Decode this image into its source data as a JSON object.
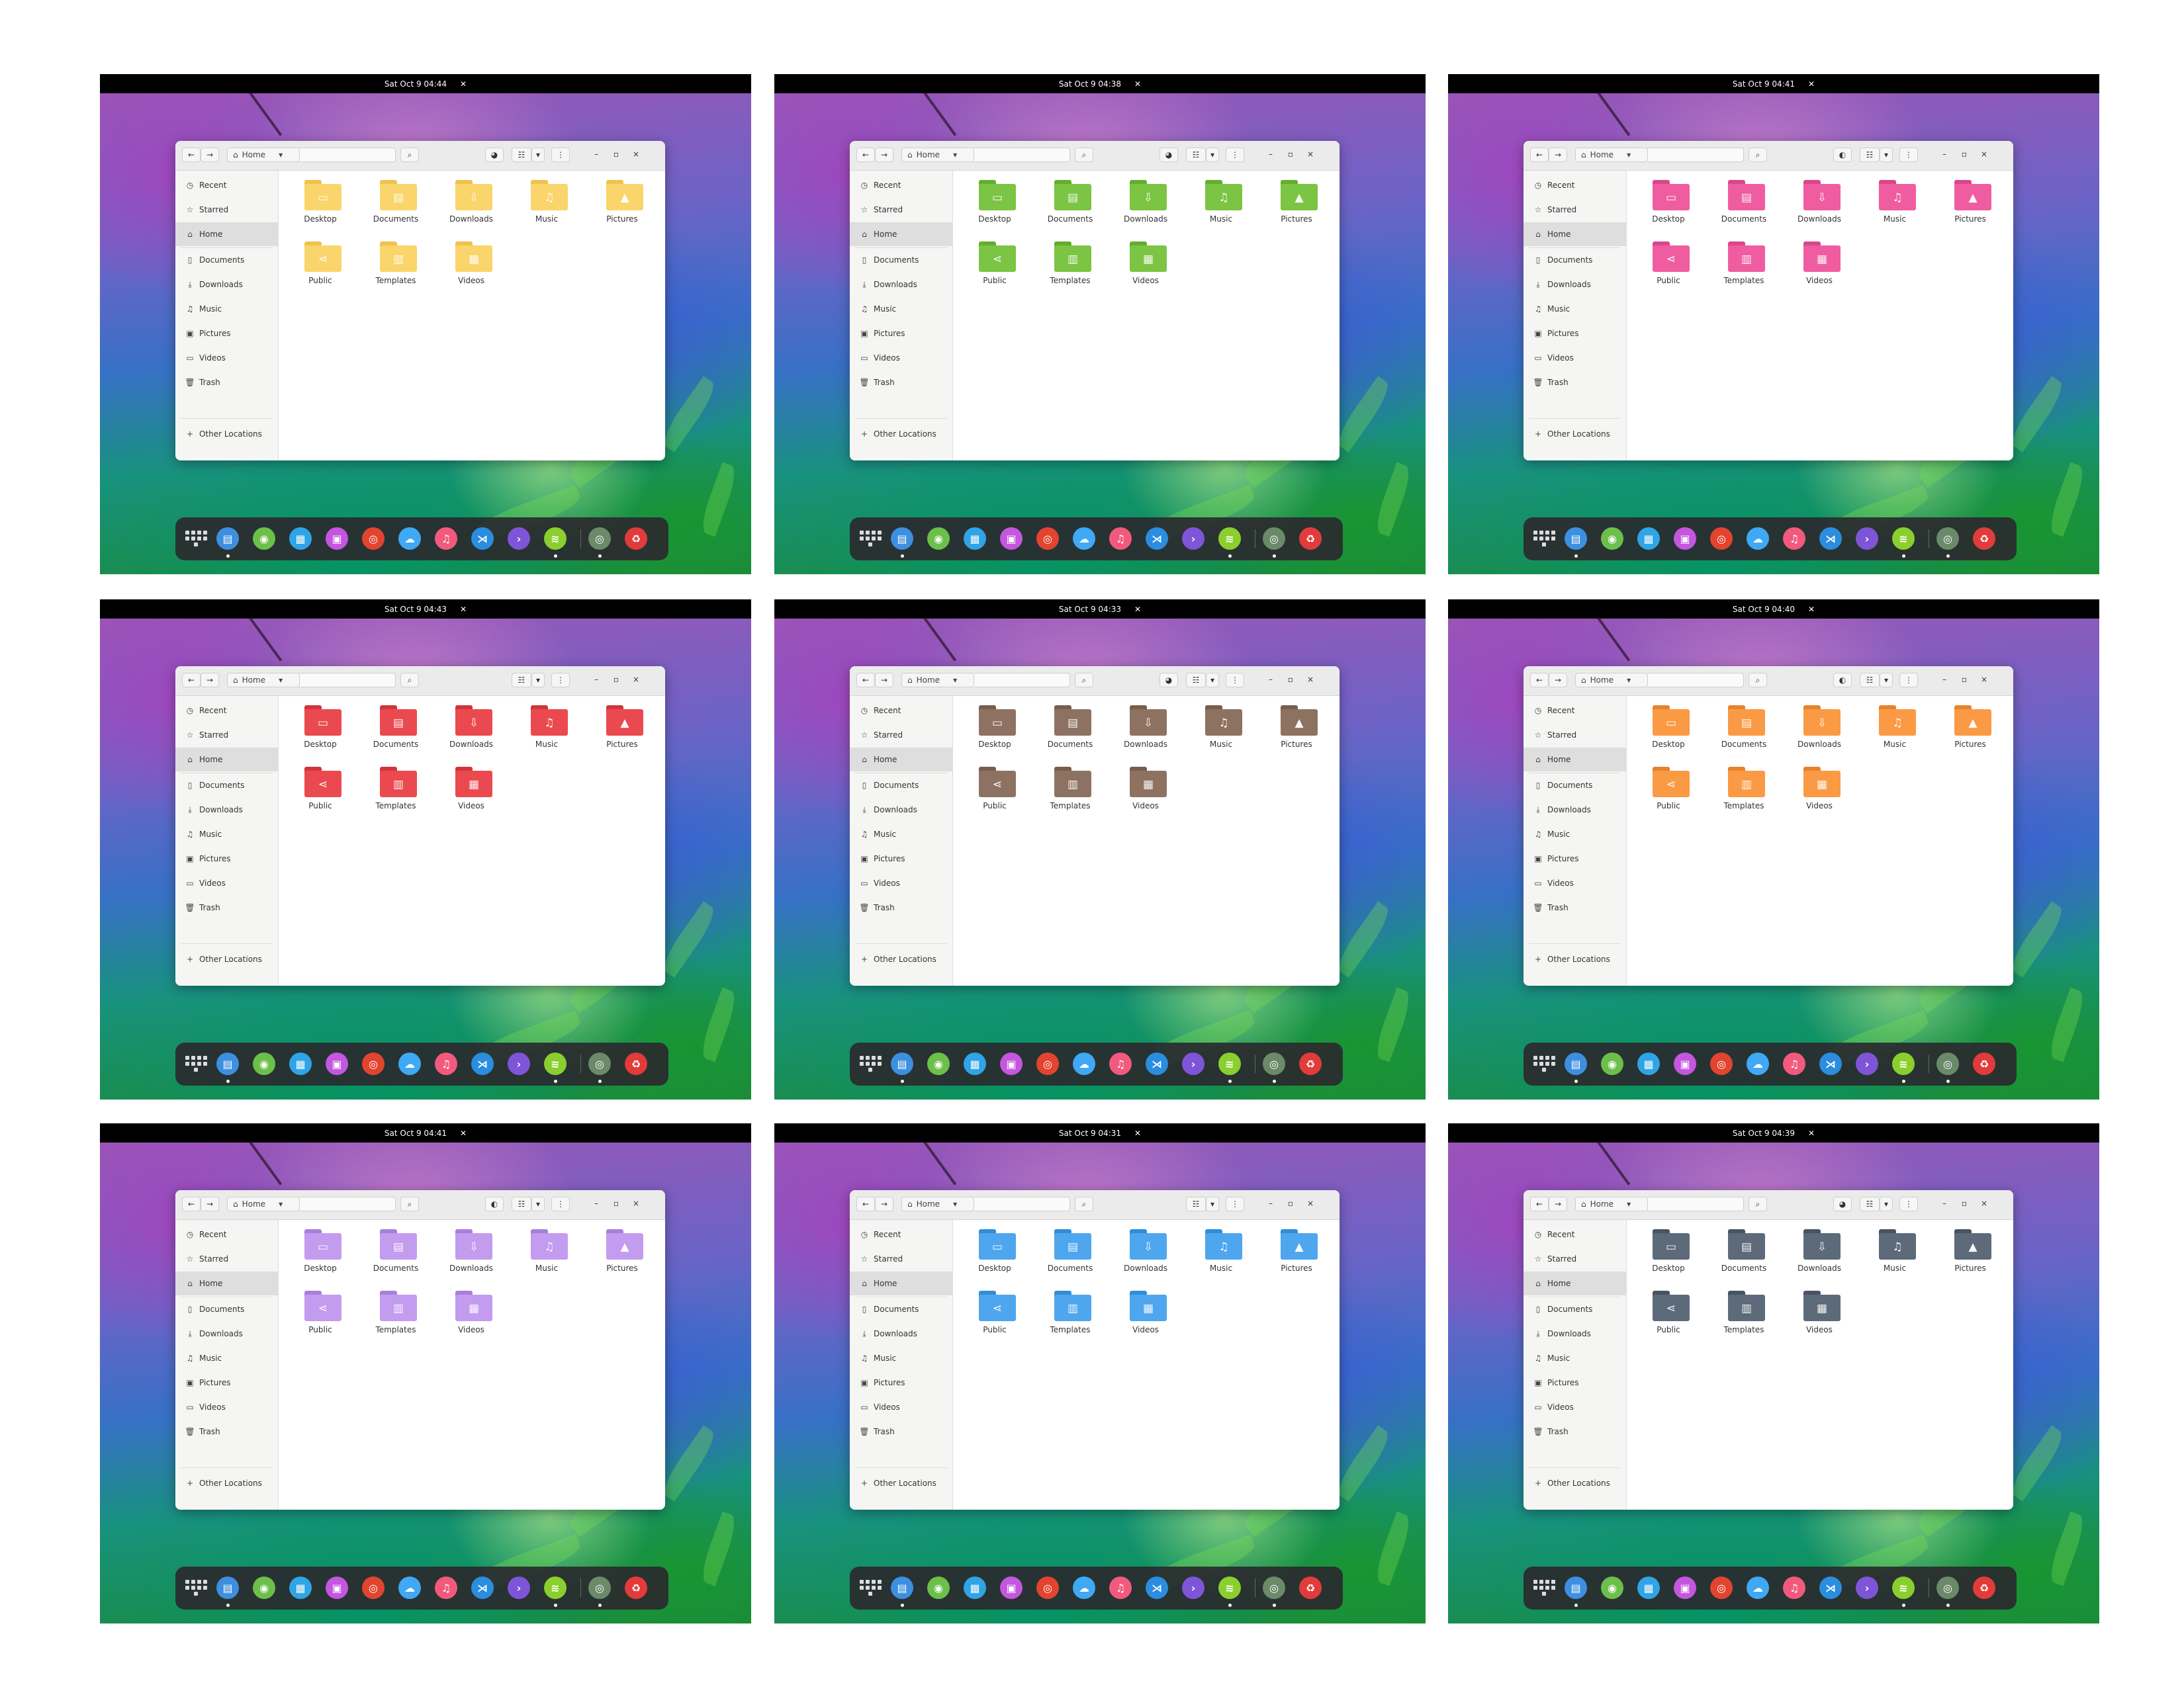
{
  "screenshots": [
    {
      "time": "Sat Oct 9  04:44",
      "folder_color": "#f9d56b",
      "folder_tab": "#efc24e",
      "has_theme_toggle": true,
      "theme_icon": "◕"
    },
    {
      "time": "Sat Oct 9  04:38",
      "folder_color": "#7cc443",
      "folder_tab": "#64ad2d",
      "has_theme_toggle": true,
      "theme_icon": "◕"
    },
    {
      "time": "Sat Oct 9  04:41",
      "folder_color": "#ef5da0",
      "folder_tab": "#d9478a",
      "has_theme_toggle": true,
      "theme_icon": "◐"
    },
    {
      "time": "Sat Oct 9  04:43",
      "folder_color": "#ea4a4f",
      "folder_tab": "#cf353b",
      "has_theme_toggle": false,
      "theme_icon": ""
    },
    {
      "time": "Sat Oct 9  04:33",
      "folder_color": "#8e7261",
      "folder_tab": "#775d4e",
      "has_theme_toggle": true,
      "theme_icon": "◕"
    },
    {
      "time": "Sat Oct 9  04:40",
      "folder_color": "#fb9a45",
      "folder_tab": "#e5822e",
      "has_theme_toggle": true,
      "theme_icon": "◐"
    },
    {
      "time": "Sat Oct 9  04:41",
      "folder_color": "#c39bef",
      "folder_tab": "#a97fdc",
      "has_theme_toggle": true,
      "theme_icon": "◐"
    },
    {
      "time": "Sat Oct 9  04:31",
      "folder_color": "#4ea6ee",
      "folder_tab": "#328dd8",
      "has_theme_toggle": false,
      "theme_icon": ""
    },
    {
      "time": "Sat Oct 9  04:39",
      "folder_color": "#5d6a79",
      "folder_tab": "#485462",
      "has_theme_toggle": true,
      "theme_icon": "◕"
    }
  ],
  "headerbar": {
    "back_icon": "←",
    "forward_icon": "→",
    "path_home_icon": "⌂",
    "path_label": "Home",
    "path_dropdown_icon": "▾",
    "search_icon": "⌕",
    "view_icon": "☷",
    "view_dropdown_icon": "▾",
    "menu_icon": "⋮",
    "minimize_icon": "–",
    "maximize_icon": "▫",
    "close_icon": "×"
  },
  "sidebar": {
    "items": [
      {
        "icon": "◷",
        "label": "Recent"
      },
      {
        "icon": "☆",
        "label": "Starred"
      },
      {
        "icon": "⌂",
        "label": "Home"
      },
      {
        "icon": "▯",
        "label": "Documents"
      },
      {
        "icon": "⤓",
        "label": "Downloads"
      },
      {
        "icon": "♫",
        "label": "Music"
      },
      {
        "icon": "▣",
        "label": "Pictures"
      },
      {
        "icon": "▭",
        "label": "Videos"
      },
      {
        "icon": "🗑",
        "label": "Trash"
      }
    ],
    "other": {
      "icon": "+",
      "label": "Other Locations"
    }
  },
  "folders": [
    {
      "label": "Desktop",
      "symbol": "▭"
    },
    {
      "label": "Documents",
      "symbol": "▤"
    },
    {
      "label": "Downloads",
      "symbol": "⇩"
    },
    {
      "label": "Music",
      "symbol": "♫"
    },
    {
      "label": "Pictures",
      "symbol": "▲"
    },
    {
      "label": "Public",
      "symbol": "⋖"
    },
    {
      "label": "Templates",
      "symbol": "▥"
    },
    {
      "label": "Videos",
      "symbol": "▦"
    }
  ],
  "dock": {
    "apps": [
      {
        "name": "files",
        "color": "#3d8fe0",
        "glyph": "▤"
      },
      {
        "name": "maps",
        "color": "#6cc04a",
        "glyph": "◉"
      },
      {
        "name": "software",
        "color": "#2fa4e6",
        "glyph": "▦"
      },
      {
        "name": "calendar",
        "color": "#c456e0",
        "glyph": "▣"
      },
      {
        "name": "chrome",
        "color": "#e2442f",
        "glyph": "◎"
      },
      {
        "name": "weather",
        "color": "#3fa9f5",
        "glyph": "☁"
      },
      {
        "name": "music",
        "color": "#f25a7d",
        "glyph": "♫"
      },
      {
        "name": "vscode",
        "color": "#2a8de0",
        "glyph": "⋊"
      },
      {
        "name": "terminal",
        "color": "#7e55d8",
        "glyph": "›"
      },
      {
        "name": "app-green",
        "color": "#8acf2e",
        "glyph": "≋"
      }
    ],
    "extra": [
      {
        "name": "settings",
        "color": "#6a8a6a",
        "glyph": "◎"
      },
      {
        "name": "trash-recycle",
        "color": "#e23b3b",
        "glyph": "♻"
      }
    ]
  }
}
